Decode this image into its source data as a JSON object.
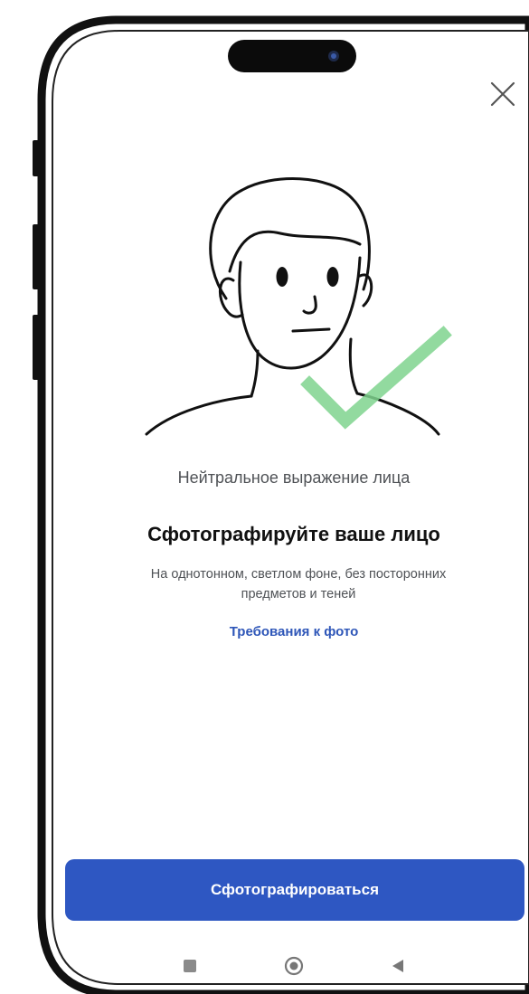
{
  "screen": {
    "caption": "Нейтральное выражение лица",
    "title": "Сфотографируйте ваше лицо",
    "description_line1": "На однотонном, светлом фоне, без посторонних",
    "description_line2": "предметов и теней",
    "link": "Требования к фото",
    "primary_button": "Сфотографироваться"
  },
  "icons": {
    "close": "close-icon",
    "face": "face-illustration-icon",
    "check": "checkmark-icon",
    "nav_square": "recent-apps-icon",
    "nav_home": "home-icon",
    "nav_back": "back-icon"
  },
  "colors": {
    "accent": "#2e57c2",
    "link": "#2e56b8",
    "check": "#7fd48e",
    "text_secondary": "#4f5256"
  }
}
